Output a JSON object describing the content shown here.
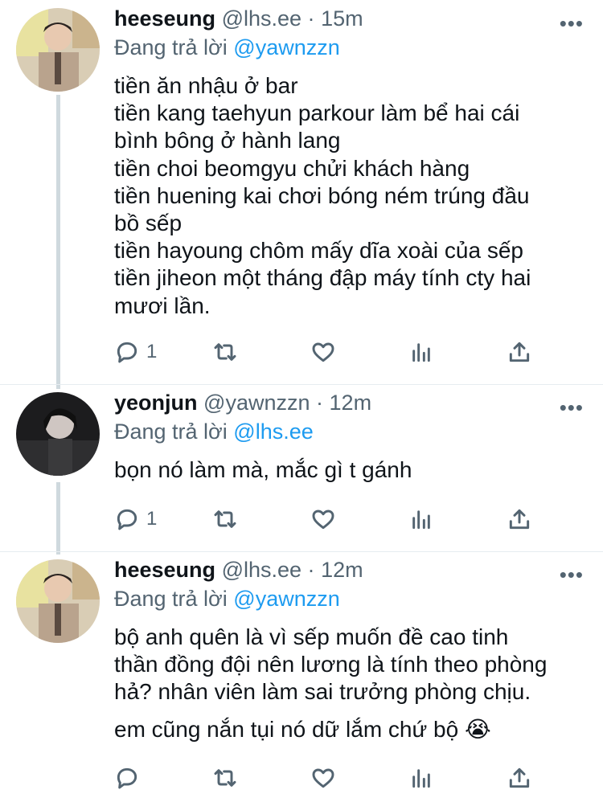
{
  "tweets": [
    {
      "name": "heeseung",
      "handle": "@lhs.ee",
      "dot": "·",
      "time": "15m",
      "reply_prefix": "Đang trả lời",
      "reply_to": "@yawnzzn",
      "lines": [
        "tiền ăn nhậu ở bar",
        "tiền kang taehyun parkour làm bể hai cái",
        "bình bông ở hành lang",
        "tiền choi beomgyu chửi khách hàng",
        "tiền huening kai chơi bóng ném trúng đầu",
        "bồ sếp",
        "tiền hayoung chôm mấy dĩa xoài của sếp",
        "tiền jiheon một tháng đập máy tính cty hai",
        "mươi lần."
      ],
      "reply_count": "1",
      "more": "•••"
    },
    {
      "name": "yeonjun",
      "handle": "@yawnzzn",
      "dot": "·",
      "time": "12m",
      "reply_prefix": "Đang trả lời",
      "reply_to": "@lhs.ee",
      "lines": [
        "bọn nó làm mà, mắc gì t gánh"
      ],
      "reply_count": "1",
      "more": "•••"
    },
    {
      "name": "heeseung",
      "handle": "@lhs.ee",
      "dot": "·",
      "time": "12m",
      "reply_prefix": "Đang trả lời",
      "reply_to": "@yawnzzn",
      "lines": [
        "bộ anh quên là vì sếp muốn đề cao tinh",
        "thần đồng đội nên lương là tính theo phòng",
        "hả? nhân viên làm sai trưởng phòng chịu."
      ],
      "extra_line": "em cũng nắn tụi nó dữ lắm chứ bộ 😭",
      "reply_count": "",
      "more": "•••"
    }
  ],
  "icons": [
    "reply-icon",
    "retweet-icon",
    "like-icon",
    "analytics-icon",
    "share-icon"
  ],
  "colors": {
    "link": "#1d9bf0",
    "secondary": "#536471",
    "text": "#0f1419",
    "thread_line": "#cfd9de"
  }
}
